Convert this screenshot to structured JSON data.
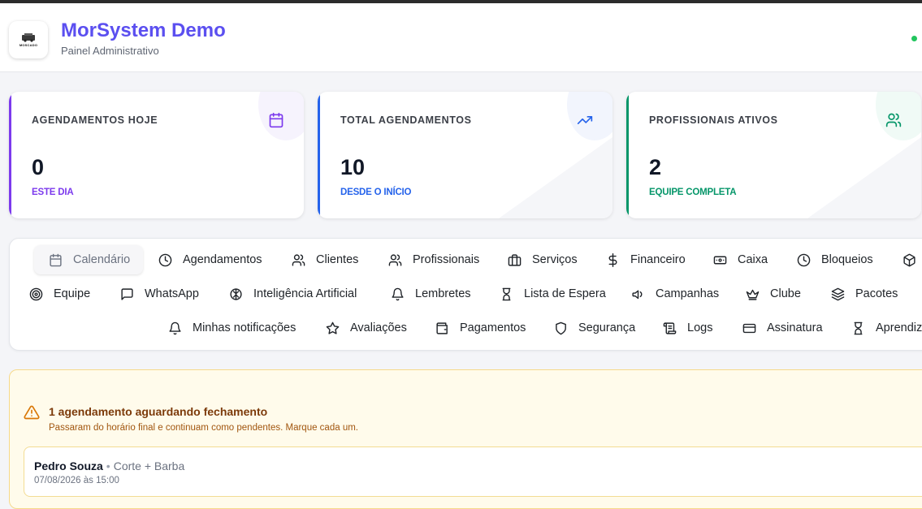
{
  "header": {
    "title": "MorSystem Demo",
    "subtitle": "Painel Administrativo",
    "logo_text": "MOSCADO",
    "status_color": "#22c55e"
  },
  "stats": [
    {
      "label": "AGENDAMENTOS HOJE",
      "value": "0",
      "caption": "ESTE DIA",
      "color": "#7c3aed",
      "icon": "calendar-icon"
    },
    {
      "label": "TOTAL AGENDAMENTOS",
      "value": "10",
      "caption": "DESDE O INÍCIO",
      "color": "#2563eb",
      "icon": "trending-up-icon"
    },
    {
      "label": "PROFISSIONAIS ATIVOS",
      "value": "2",
      "caption": "EQUIPE COMPLETA",
      "color": "#059669",
      "icon": "users-icon"
    }
  ],
  "nav": {
    "row1": [
      "Calendário",
      "Agendamentos",
      "Clientes",
      "Profissionais",
      "Serviços",
      "Financeiro",
      "Caixa",
      "Bloqueios"
    ],
    "row2": [
      "Equipe",
      "WhatsApp",
      "Inteligência Artificial",
      "Lembretes",
      "Lista de Espera",
      "Campanhas",
      "Clube",
      "Pacotes"
    ],
    "row3": [
      "Minhas notificações",
      "Avaliações",
      "Pagamentos",
      "Segurança",
      "Logs",
      "Assinatura",
      "Aprendiz"
    ],
    "active": "Calendário"
  },
  "alert": {
    "title": "1 agendamento aguardando fechamento",
    "description": "Passaram do horário final e continuam como pendentes. Marque cada um.",
    "items": [
      {
        "name": "Pedro Souza",
        "separator": "•",
        "service": "Corte + Barba",
        "datetime": "07/08/2026 às 15:00"
      }
    ]
  }
}
